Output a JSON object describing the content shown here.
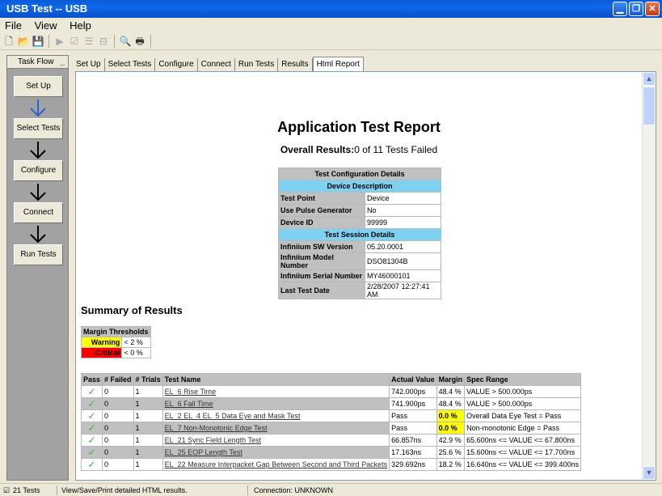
{
  "window": {
    "title": "USB Test -- USB"
  },
  "menu": [
    "File",
    "View",
    "Help"
  ],
  "toolbar": [
    {
      "icon": "new-icon",
      "glyph": "🗋",
      "enabled": true
    },
    {
      "icon": "open-icon",
      "glyph": "📂",
      "enabled": true
    },
    {
      "icon": "save-icon",
      "glyph": "💾",
      "enabled": false
    },
    {
      "icon": "run-icon",
      "glyph": "▶",
      "enabled": false
    },
    {
      "icon": "select-icon",
      "glyph": "☑",
      "enabled": false
    },
    {
      "icon": "list-icon",
      "glyph": "☰",
      "enabled": false
    },
    {
      "icon": "tree-icon",
      "glyph": "⊟",
      "enabled": false
    },
    {
      "icon": "print-preview-icon",
      "glyph": "🔍",
      "enabled": true
    },
    {
      "icon": "print-icon",
      "glyph": "🖶",
      "enabled": true
    }
  ],
  "taskflow": {
    "header": "Task Flow",
    "steps": [
      "Set Up",
      "Select Tests",
      "Configure",
      "Connect",
      "Run Tests"
    ]
  },
  "tabs": [
    "Set Up",
    "Select Tests",
    "Configure",
    "Connect",
    "Run Tests",
    "Results",
    "Html Report"
  ],
  "active_tab": "Html Report",
  "report": {
    "title": "Application Test Report",
    "overall_label": "Overall Results:",
    "overall_value": "0 of 11 Tests Failed",
    "config": {
      "header": "Test Configuration Details",
      "device_header": "Device Description",
      "device_rows": [
        {
          "label": "Test Point",
          "value": "Device"
        },
        {
          "label": "Use Pulse Generator",
          "value": "No"
        },
        {
          "label": "Device ID",
          "value": "99999"
        }
      ],
      "session_header": "Test Session Details",
      "session_rows": [
        {
          "label": "Infiniium SW Version",
          "value": "05.20.0001"
        },
        {
          "label": "Infiniium Model Number",
          "value": "DSO81304B"
        },
        {
          "label": "Infiniium Serial Number",
          "value": "MY46000101"
        },
        {
          "label": "Last Test Date",
          "value": "2/28/2007 12:27:41 AM"
        }
      ]
    },
    "summary_title": "Summary of Results",
    "thresholds": {
      "header": "Margin Thresholds",
      "warning_label": "Warning",
      "warning_value": "< 2 %",
      "critical_label": "Critical",
      "critical_value": "< 0 %"
    },
    "results_headers": [
      "Pass",
      "# Failed",
      "# Trials",
      "Test Name",
      "Actual Value",
      "Margin",
      "Spec Range"
    ],
    "results": [
      {
        "failed": "0",
        "trials": "1",
        "name": "EL_6 Rise Time",
        "actual": "742.000ps",
        "margin": "48.4 %",
        "warn": false,
        "spec": "VALUE > 500.000ps"
      },
      {
        "failed": "0",
        "trials": "1",
        "name": "EL_6 Fall Time",
        "actual": "741.900ps",
        "margin": "48.4 %",
        "warn": false,
        "spec": "VALUE > 500.000ps"
      },
      {
        "failed": "0",
        "trials": "1",
        "name": "EL_2 EL_4 EL_5 Data Eye and Mask Test",
        "actual": "Pass",
        "margin": "0.0 %",
        "warn": true,
        "spec": "Overall Data Eye Test = Pass"
      },
      {
        "failed": "0",
        "trials": "1",
        "name": "EL_7 Non-Monotonic Edge Test",
        "actual": "Pass",
        "margin": "0.0 %",
        "warn": true,
        "spec": "Non-monotonic Edge = Pass"
      },
      {
        "failed": "0",
        "trials": "1",
        "name": "EL_21 Sync Field Length Test",
        "actual": "66.857ns",
        "margin": "42.9 %",
        "warn": false,
        "spec": "65.600ns <= VALUE <= 67.800ns"
      },
      {
        "failed": "0",
        "trials": "1",
        "name": "EL_25 EOP Length Test",
        "actual": "17.163ns",
        "margin": "25.6 %",
        "warn": false,
        "spec": "15.600ns <= VALUE <= 17.700ns"
      },
      {
        "failed": "0",
        "trials": "1",
        "name": "EL_22 Measure Interpacket Gap Between Second and Third Packets",
        "actual": "329.692ns",
        "margin": "18.2 %",
        "warn": false,
        "spec": "16.640ns <= VALUE <= 399.400ns"
      }
    ]
  },
  "status": {
    "tests": "21 Tests",
    "message": "View/Save/Print detailed HTML results.",
    "connection": "Connection: UNKNOWN"
  },
  "colors": {
    "titlebar": "#0a5ad6",
    "warning": "#ffff00",
    "critical": "#ff0000",
    "section_blue": "#7fd1f2",
    "pass_check": "#3bb54a"
  }
}
